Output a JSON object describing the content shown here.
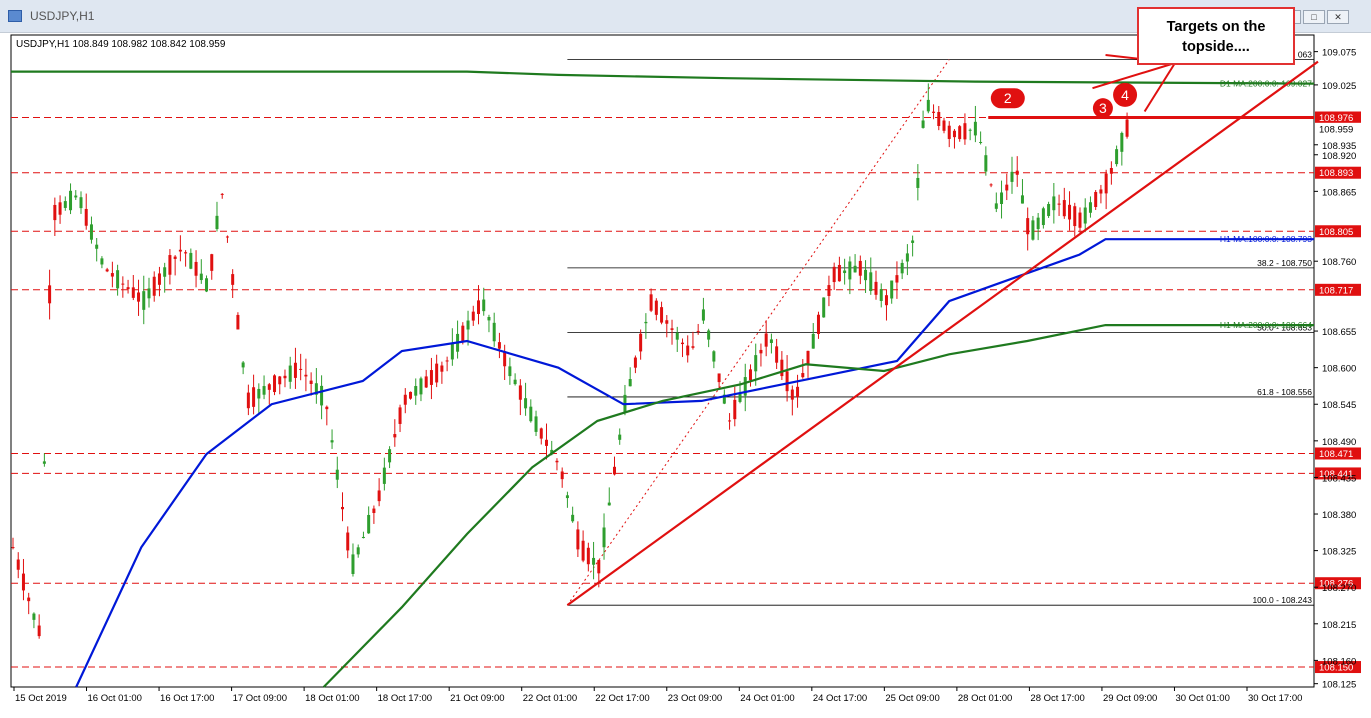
{
  "window": {
    "title": "USDJPY,H1",
    "buttons": [
      "_",
      "□",
      "✕"
    ]
  },
  "symbol_info": "USDJPY,H1  108.849 108.982 108.842 108.959",
  "callout": {
    "line1": "Targets on the",
    "line2": "topside...."
  },
  "colors": {
    "bull": "#2e9e2e",
    "bear": "#e01010",
    "ma100": "#0018d8",
    "ma200": "#1f7a1f",
    "trend": "#e01010",
    "level_bg": "#e01010"
  },
  "chart_data": {
    "type": "candlestick",
    "symbol": "USDJPY",
    "timeframe": "H1",
    "ylim": [
      108.12,
      109.1
    ],
    "x_labels": [
      "15 Oct 2019",
      "16 Oct 01:00",
      "16 Oct 17:00",
      "17 Oct 09:00",
      "18 Oct 01:00",
      "18 Oct 17:00",
      "21 Oct 09:00",
      "22 Oct 01:00",
      "22 Oct 17:00",
      "23 Oct 09:00",
      "24 Oct 01:00",
      "24 Oct 17:00",
      "25 Oct 09:00",
      "28 Oct 01:00",
      "28 Oct 17:00",
      "29 Oct 09:00",
      "30 Oct 01:00",
      "30 Oct 17:00"
    ],
    "y_ticks": [
      "109.075",
      "109.025",
      "108.935",
      "108.920",
      "108.865",
      "108.760",
      "108.655",
      "108.600",
      "108.545",
      "108.490",
      "108.435",
      "108.380",
      "108.325",
      "108.270",
      "108.215",
      "108.160",
      "108.125"
    ],
    "price_level_labels": [
      {
        "value": "108.976",
        "style": "red"
      },
      {
        "value": "108.959",
        "style": "current"
      },
      {
        "value": "108.893",
        "style": "red"
      },
      {
        "value": "108.805",
        "style": "red"
      },
      {
        "value": "108.717",
        "style": "red"
      },
      {
        "value": "108.471",
        "style": "red"
      },
      {
        "value": "108.441",
        "style": "red"
      },
      {
        "value": "108.276",
        "style": "red"
      },
      {
        "value": "108.150",
        "style": "red"
      }
    ],
    "fibonacci": [
      {
        "label": "38.2 - 108.750",
        "value": 108.75
      },
      {
        "label": "50.0 - 108.653",
        "value": 108.653
      },
      {
        "label": "61.8 - 108.556",
        "value": 108.556
      },
      {
        "label": "100.0 - 108.243",
        "value": 108.243
      },
      {
        "label": "063",
        "value": 109.063
      }
    ],
    "indicator_labels": [
      {
        "label": "D1 MA:200:0:0: 109.027",
        "value": 109.027,
        "color": "#1f7a1f"
      },
      {
        "label": "H1 MA:100:0:0: 108.793",
        "value": 108.793,
        "color": "#0018d8"
      },
      {
        "label": "H1 MA:200:0:0: 108.664",
        "value": 108.664,
        "color": "#1f7a1f"
      }
    ],
    "markers": [
      "2",
      "3",
      "4"
    ],
    "resistance_level": 108.976,
    "series": [
      {
        "name": "D1 MA:200",
        "points": [
          [
            0,
            109.045
          ],
          [
            0.35,
            109.045
          ],
          [
            0.42,
            109.04
          ],
          [
            0.55,
            109.035
          ],
          [
            0.74,
            109.03
          ],
          [
            1.0,
            109.027
          ]
        ]
      },
      {
        "name": "H1 MA:100",
        "points": [
          [
            0.05,
            108.12
          ],
          [
            0.1,
            108.33
          ],
          [
            0.15,
            108.47
          ],
          [
            0.2,
            108.545
          ],
          [
            0.27,
            108.58
          ],
          [
            0.3,
            108.625
          ],
          [
            0.35,
            108.64
          ],
          [
            0.42,
            108.6
          ],
          [
            0.47,
            108.545
          ],
          [
            0.53,
            108.55
          ],
          [
            0.58,
            108.57
          ],
          [
            0.63,
            108.59
          ],
          [
            0.68,
            108.61
          ],
          [
            0.72,
            108.7
          ],
          [
            0.77,
            108.735
          ],
          [
            0.82,
            108.77
          ],
          [
            0.84,
            108.793
          ],
          [
            1.0,
            108.793
          ]
        ]
      },
      {
        "name": "H1 MA:200",
        "points": [
          [
            0.24,
            108.12
          ],
          [
            0.3,
            108.24
          ],
          [
            0.35,
            108.35
          ],
          [
            0.4,
            108.45
          ],
          [
            0.45,
            108.52
          ],
          [
            0.5,
            108.55
          ],
          [
            0.56,
            108.575
          ],
          [
            0.61,
            108.605
          ],
          [
            0.67,
            108.595
          ],
          [
            0.72,
            108.62
          ],
          [
            0.78,
            108.64
          ],
          [
            0.84,
            108.664
          ],
          [
            1.0,
            108.664
          ]
        ]
      }
    ]
  }
}
